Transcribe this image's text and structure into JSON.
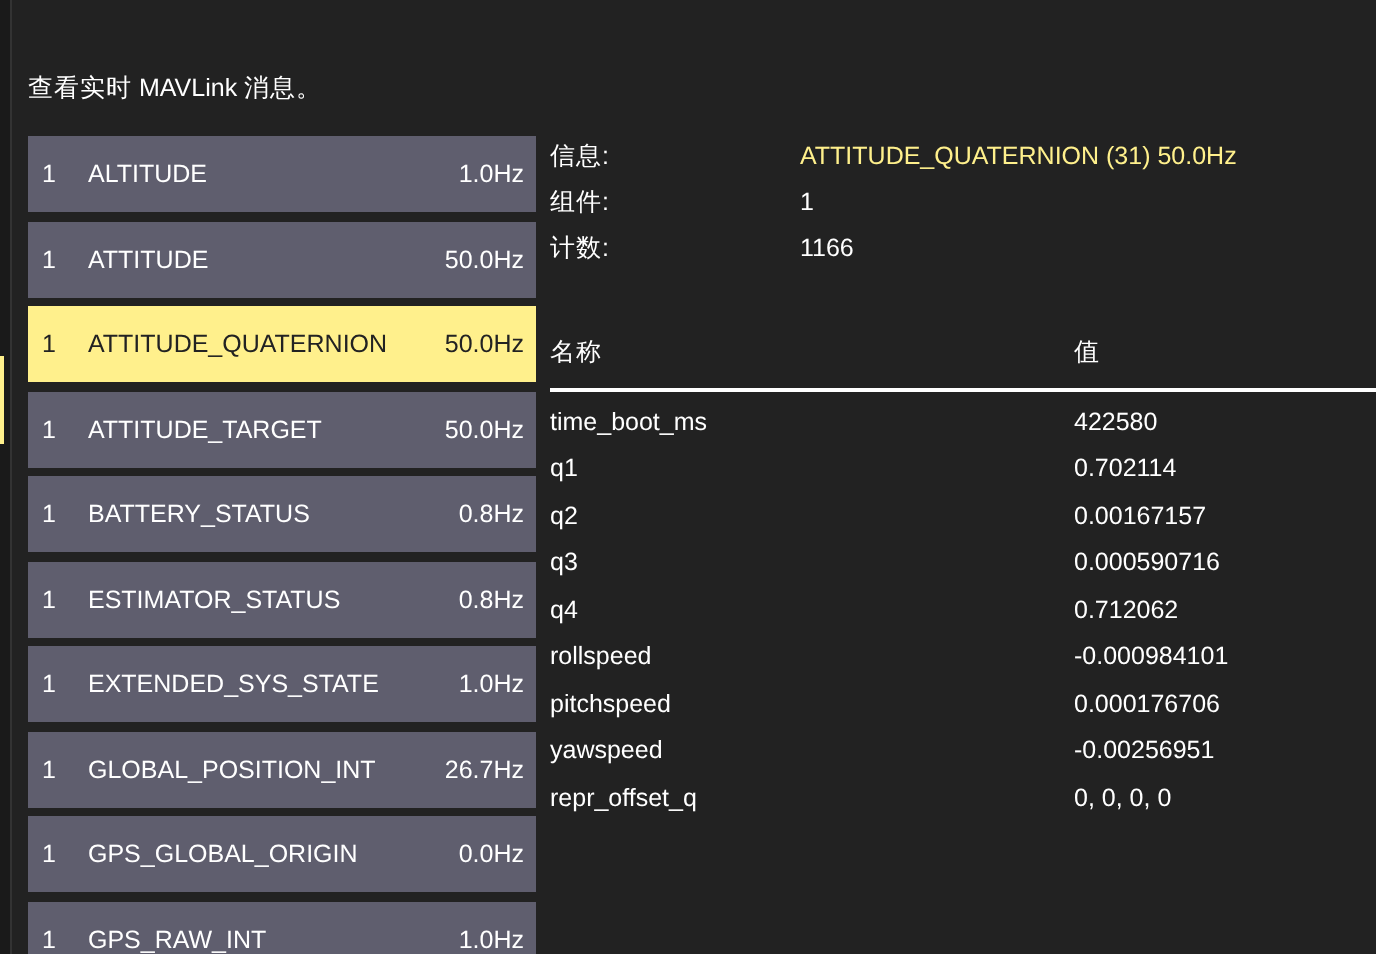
{
  "description": "查看实时 MAVLink 消息。",
  "messages": [
    {
      "component": "1",
      "name": "ALTITUDE",
      "rate": "1.0Hz",
      "selected": false
    },
    {
      "component": "1",
      "name": "ATTITUDE",
      "rate": "50.0Hz",
      "selected": false
    },
    {
      "component": "1",
      "name": "ATTITUDE_QUATERNION",
      "rate": "50.0Hz",
      "selected": true
    },
    {
      "component": "1",
      "name": "ATTITUDE_TARGET",
      "rate": "50.0Hz",
      "selected": false
    },
    {
      "component": "1",
      "name": "BATTERY_STATUS",
      "rate": "0.8Hz",
      "selected": false
    },
    {
      "component": "1",
      "name": "ESTIMATOR_STATUS",
      "rate": "0.8Hz",
      "selected": false
    },
    {
      "component": "1",
      "name": "EXTENDED_SYS_STATE",
      "rate": "1.0Hz",
      "selected": false
    },
    {
      "component": "1",
      "name": "GLOBAL_POSITION_INT",
      "rate": "26.7Hz",
      "selected": false
    },
    {
      "component": "1",
      "name": "GPS_GLOBAL_ORIGIN",
      "rate": "0.0Hz",
      "selected": false
    },
    {
      "component": "1",
      "name": "GPS_RAW_INT",
      "rate": "1.0Hz",
      "selected": false
    }
  ],
  "info": [
    {
      "label": "信息:",
      "value": "ATTITUDE_QUATERNION (31) 50.0Hz",
      "kind": "highlight"
    },
    {
      "label": "组件:",
      "value": "1",
      "kind": "plain"
    },
    {
      "label": "计数:",
      "value": "1166",
      "kind": "plain"
    }
  ],
  "fields_table": {
    "columns": [
      "名称",
      "值"
    ],
    "rows": [
      [
        "time_boot_ms",
        "422580"
      ],
      [
        "q1",
        "0.702114"
      ],
      [
        "q2",
        "0.00167157"
      ],
      [
        "q3",
        "0.000590716"
      ],
      [
        "q4",
        "0.712062"
      ],
      [
        "rollspeed",
        "-0.000984101"
      ],
      [
        "pitchspeed",
        "0.000176706"
      ],
      [
        "yawspeed",
        "-0.00256951"
      ],
      [
        "repr_offset_q",
        "0, 0, 0, 0"
      ]
    ]
  }
}
